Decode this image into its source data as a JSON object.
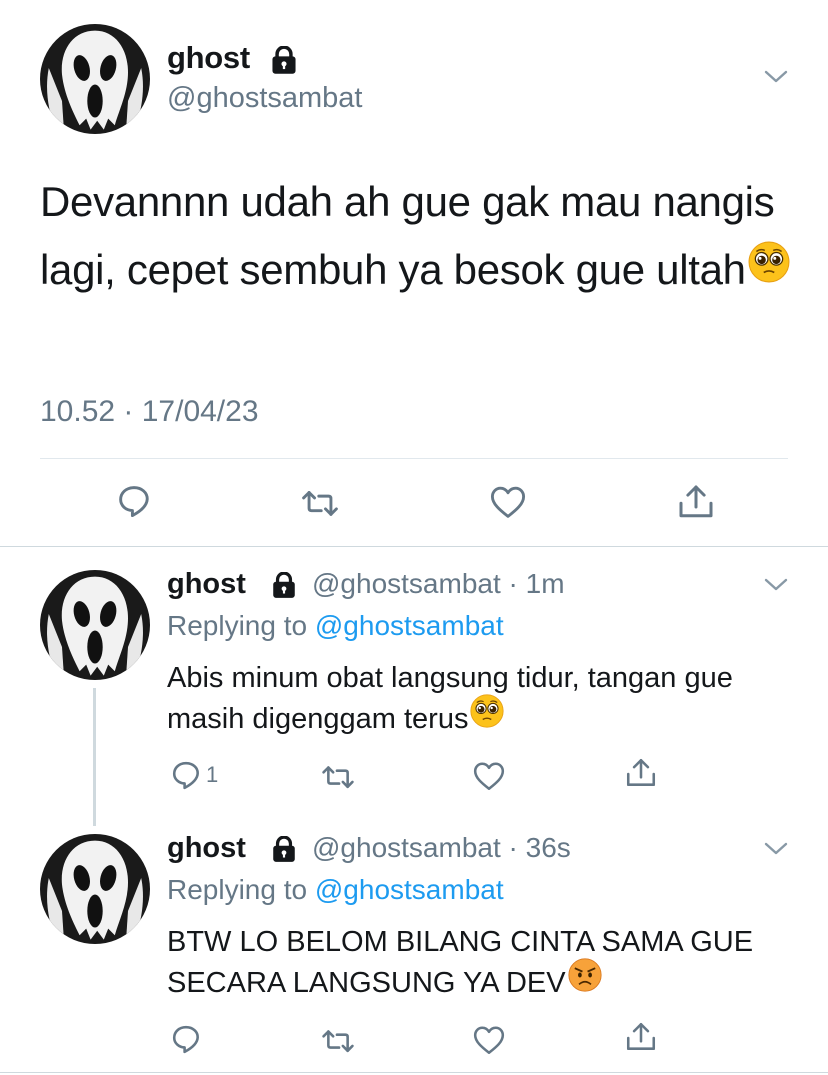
{
  "main_tweet": {
    "name": "ghost",
    "handle": "@ghostsambat",
    "text": "Devannnn udah ah gue gak mau nangis lagi, cepet sembuh ya besok gue ultah",
    "emoji": "pleading-face",
    "timestamp": "10.52 · 17/04/23",
    "actions": [
      "reply",
      "retweet",
      "like",
      "share"
    ]
  },
  "replies": [
    {
      "name": "ghost",
      "handle": "@ghostsambat",
      "age": "1m",
      "replying_to_prefix": "Replying to",
      "replying_to": "@ghostsambat",
      "text": "Abis minum obat langsung tidur, tangan gue masih digenggam terus",
      "emoji": "pleading-face",
      "reply_count": "1"
    },
    {
      "name": "ghost",
      "handle": "@ghostsambat",
      "age": "36s",
      "replying_to_prefix": "Replying to",
      "replying_to": "@ghostsambat",
      "text": "BTW LO BELOM BILANG CINTA SAMA GUE SECARA LANGSUNG YA DEV",
      "emoji": "angry-face",
      "reply_count": ""
    }
  ],
  "colors": {
    "text": "#14171a",
    "secondary": "#657786",
    "link": "#1d9bf0",
    "divider": "#e1e8ed"
  }
}
